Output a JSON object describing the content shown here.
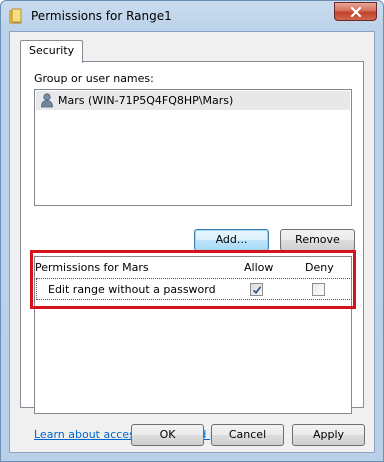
{
  "window": {
    "title": "Permissions for Range1"
  },
  "tabs": [
    {
      "label": "Security"
    }
  ],
  "group_section": {
    "label": "Group or user names:",
    "items": [
      {
        "label": "Mars (WIN-71P5Q4FQ8HP\\Mars)",
        "icon": "user-icon"
      }
    ]
  },
  "buttons": {
    "add": "Add...",
    "remove": "Remove",
    "ok": "OK",
    "cancel": "Cancel",
    "apply": "Apply"
  },
  "permissions": {
    "header": "Permissions for Mars",
    "allow_label": "Allow",
    "deny_label": "Deny",
    "rows": [
      {
        "name": "Edit range without a password",
        "allow": true,
        "deny": false
      }
    ]
  },
  "learn_link": "Learn about access control and permissions",
  "colors": {
    "highlight_outline": "#d6121c",
    "link": "#0066cc"
  }
}
